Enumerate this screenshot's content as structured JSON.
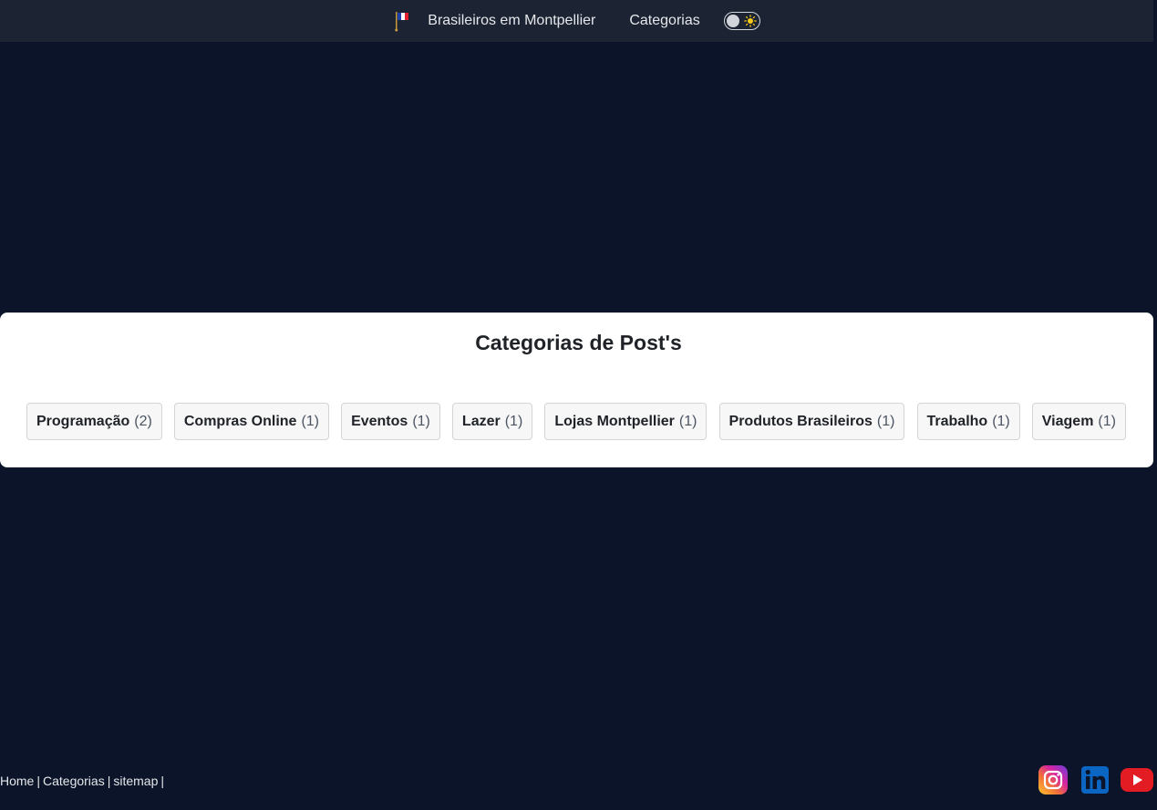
{
  "header": {
    "brand_label": "Brasileiros em Montpellier",
    "nav_categories": "Categorias",
    "flag_icon": "france-flag-icon",
    "theme_toggle_icon": "sun-icon"
  },
  "main": {
    "title": "Categorias de Post's",
    "tags": [
      {
        "name": "Programação",
        "count": "(2)"
      },
      {
        "name": "Compras Online",
        "count": "(1)"
      },
      {
        "name": "Eventos",
        "count": "(1)"
      },
      {
        "name": "Lazer",
        "count": "(1)"
      },
      {
        "name": "Lojas Montpellier",
        "count": "(1)"
      },
      {
        "name": "Produtos Brasileiros",
        "count": "(1)"
      },
      {
        "name": "Trabalho",
        "count": "(1)"
      },
      {
        "name": "Viagem",
        "count": "(1)"
      }
    ]
  },
  "footer": {
    "links": [
      "Home",
      "Categorias",
      "sitemap"
    ],
    "separator": "|",
    "social": [
      "instagram-icon",
      "linkedin-icon",
      "youtube-icon"
    ]
  },
  "colors": {
    "background": "#0b1428",
    "navbar": "#1c2333",
    "card": "#ffffff",
    "youtube": "#e31b23",
    "linkedin": "#0a66c2"
  }
}
